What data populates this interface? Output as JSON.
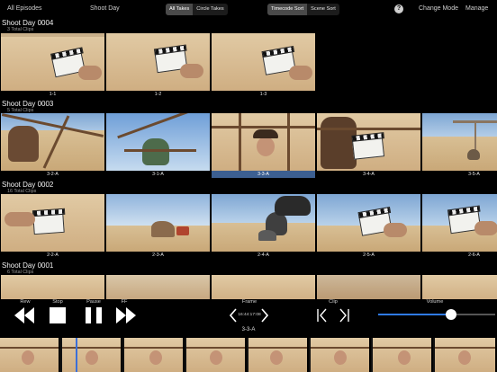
{
  "nav": {
    "all_episodes": "All Episodes",
    "shoot_day": "Shoot Day",
    "all_takes": "All Takes",
    "circle_takes": "Circle Takes",
    "timecode_sort": "Timecode Sort",
    "scene_sort": "Scene Sort",
    "help": "?",
    "change_mode": "Change Mode",
    "manage": "Manage"
  },
  "sections": [
    {
      "title": "Shoot Day 0004",
      "count": "3 Total Clips",
      "clips": [
        "1-1",
        "1-2",
        "1-3"
      ]
    },
    {
      "title": "Shoot Day 0003",
      "count": "5 Total Clips",
      "clips": [
        "3-2-A",
        "3-1-A",
        "3-3-A",
        "3-4-A",
        "3-5-A"
      ],
      "selected": "3-3-A"
    },
    {
      "title": "Shoot Day 0002",
      "count": "16 Total Clips",
      "clips": [
        "2-2-A",
        "2-3-A",
        "2-4-A",
        "2-5-A",
        "2-6-A"
      ]
    },
    {
      "title": "Shoot Day 0001",
      "count": "6 Total Clips",
      "clips": []
    }
  ],
  "controls": {
    "rew": "Rew",
    "stop": "Stop",
    "pause": "Pause",
    "ff": "FF",
    "frame": "Frame",
    "timecode": "16:44:17:08",
    "clip": "Clip",
    "volume": "Volume",
    "volume_level": 0.62,
    "current_clip": "3-3-A"
  },
  "colors": {
    "accent": "#2f7ae5",
    "selected_caption": "#3c5f91"
  }
}
